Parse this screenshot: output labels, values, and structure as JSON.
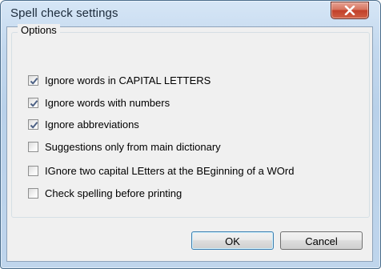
{
  "window": {
    "title": "Spell check settings"
  },
  "options_group": {
    "legend": "Options",
    "items": [
      {
        "label": "Ignore words in CAPITAL LETTERS",
        "checked": true
      },
      {
        "label": "Ignore words with numbers",
        "checked": true
      },
      {
        "label": "Ignore abbreviations",
        "checked": true
      },
      {
        "label": "Suggestions only from main dictionary",
        "checked": false
      },
      {
        "label": "IGnore two capital LEtters at the BEginning of a WOrd",
        "checked": false
      },
      {
        "label": "Check spelling before printing",
        "checked": false
      }
    ]
  },
  "buttons": {
    "ok_label": "OK",
    "cancel_label": "Cancel"
  },
  "colors": {
    "check_mark": "#4d6185",
    "close_button": "#c2402a"
  }
}
